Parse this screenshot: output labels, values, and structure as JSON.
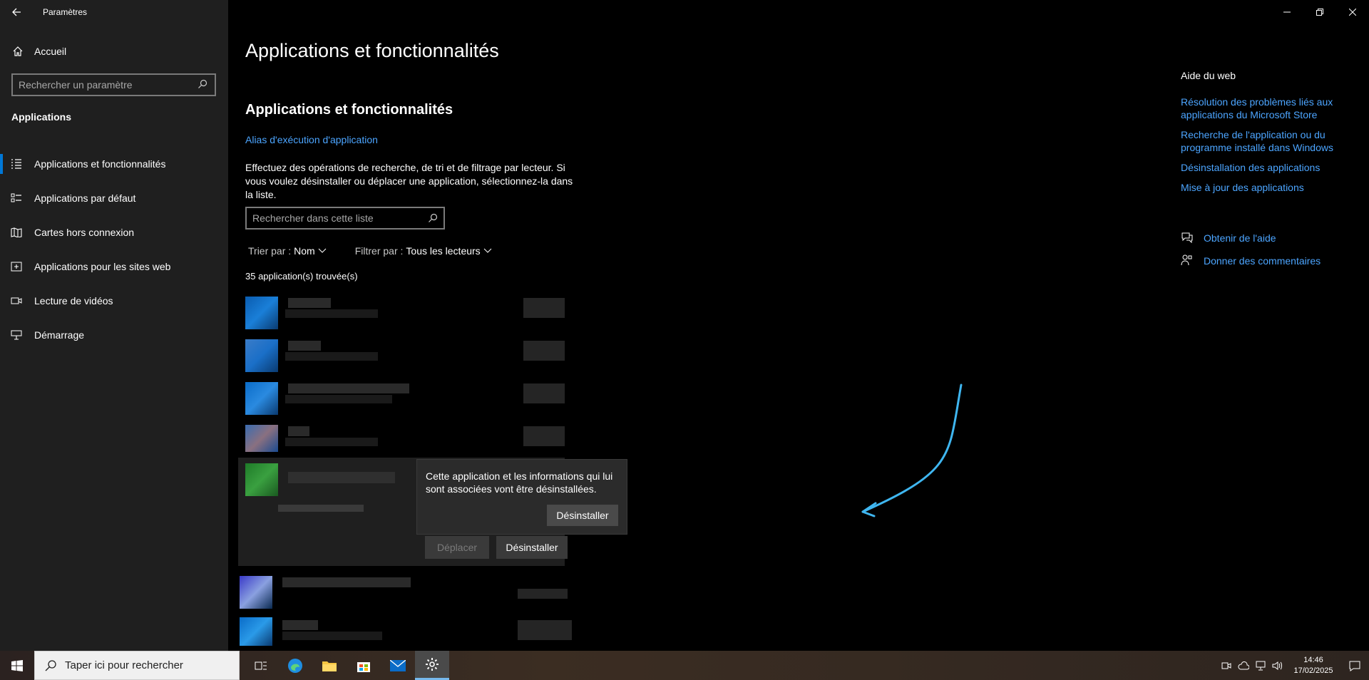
{
  "window": {
    "title": "Paramètres"
  },
  "sidebar": {
    "home_label": "Accueil",
    "search_placeholder": "Rechercher un paramètre",
    "section_title": "Applications",
    "items": [
      {
        "label": "Applications et fonctionnalités",
        "icon": "list-icon",
        "active": true
      },
      {
        "label": "Applications par défaut",
        "icon": "default-apps-icon",
        "active": false
      },
      {
        "label": "Cartes hors connexion",
        "icon": "map-icon",
        "active": false
      },
      {
        "label": "Applications pour les sites web",
        "icon": "web-apps-icon",
        "active": false
      },
      {
        "label": "Lecture de vidéos",
        "icon": "video-icon",
        "active": false
      },
      {
        "label": "Démarrage",
        "icon": "startup-icon",
        "active": false
      }
    ]
  },
  "main": {
    "page_title": "Applications et fonctionnalités",
    "sub_title": "Applications et fonctionnalités",
    "alias_link": "Alias d'exécution d'application",
    "description": "Effectuez des opérations de recherche, de tri et de filtrage par lecteur. Si vous voulez désinstaller ou déplacer une application, sélectionnez-la dans la liste.",
    "list_search_placeholder": "Rechercher dans cette liste",
    "sort_label": "Trier par :",
    "sort_value": "Nom",
    "filter_label": "Filtrer par :",
    "filter_value": "Tous les lecteurs",
    "count_text": "35 application(s) trouvée(s)",
    "move_button": "Déplacer",
    "uninstall_button": "Désinstaller"
  },
  "flyout": {
    "text": "Cette application et les informations qui lui sont associées vont être désinstallées.",
    "button": "Désinstaller"
  },
  "help": {
    "title": "Aide du web",
    "links": [
      "Résolution des problèmes liés aux applications du Microsoft Store",
      "Recherche de l'application ou du programme installé dans Windows",
      "Désinstallation des applications",
      "Mise à jour des applications"
    ],
    "get_help": "Obtenir de l'aide",
    "feedback": "Donner des commentaires"
  },
  "taskbar": {
    "search_placeholder": "Taper ici pour rechercher",
    "time": "14:46",
    "date": "17/02/2025"
  },
  "colors": {
    "accent": "#0078d7",
    "link": "#4ca5ff",
    "annotation_arrow": "#3fb6f0"
  }
}
